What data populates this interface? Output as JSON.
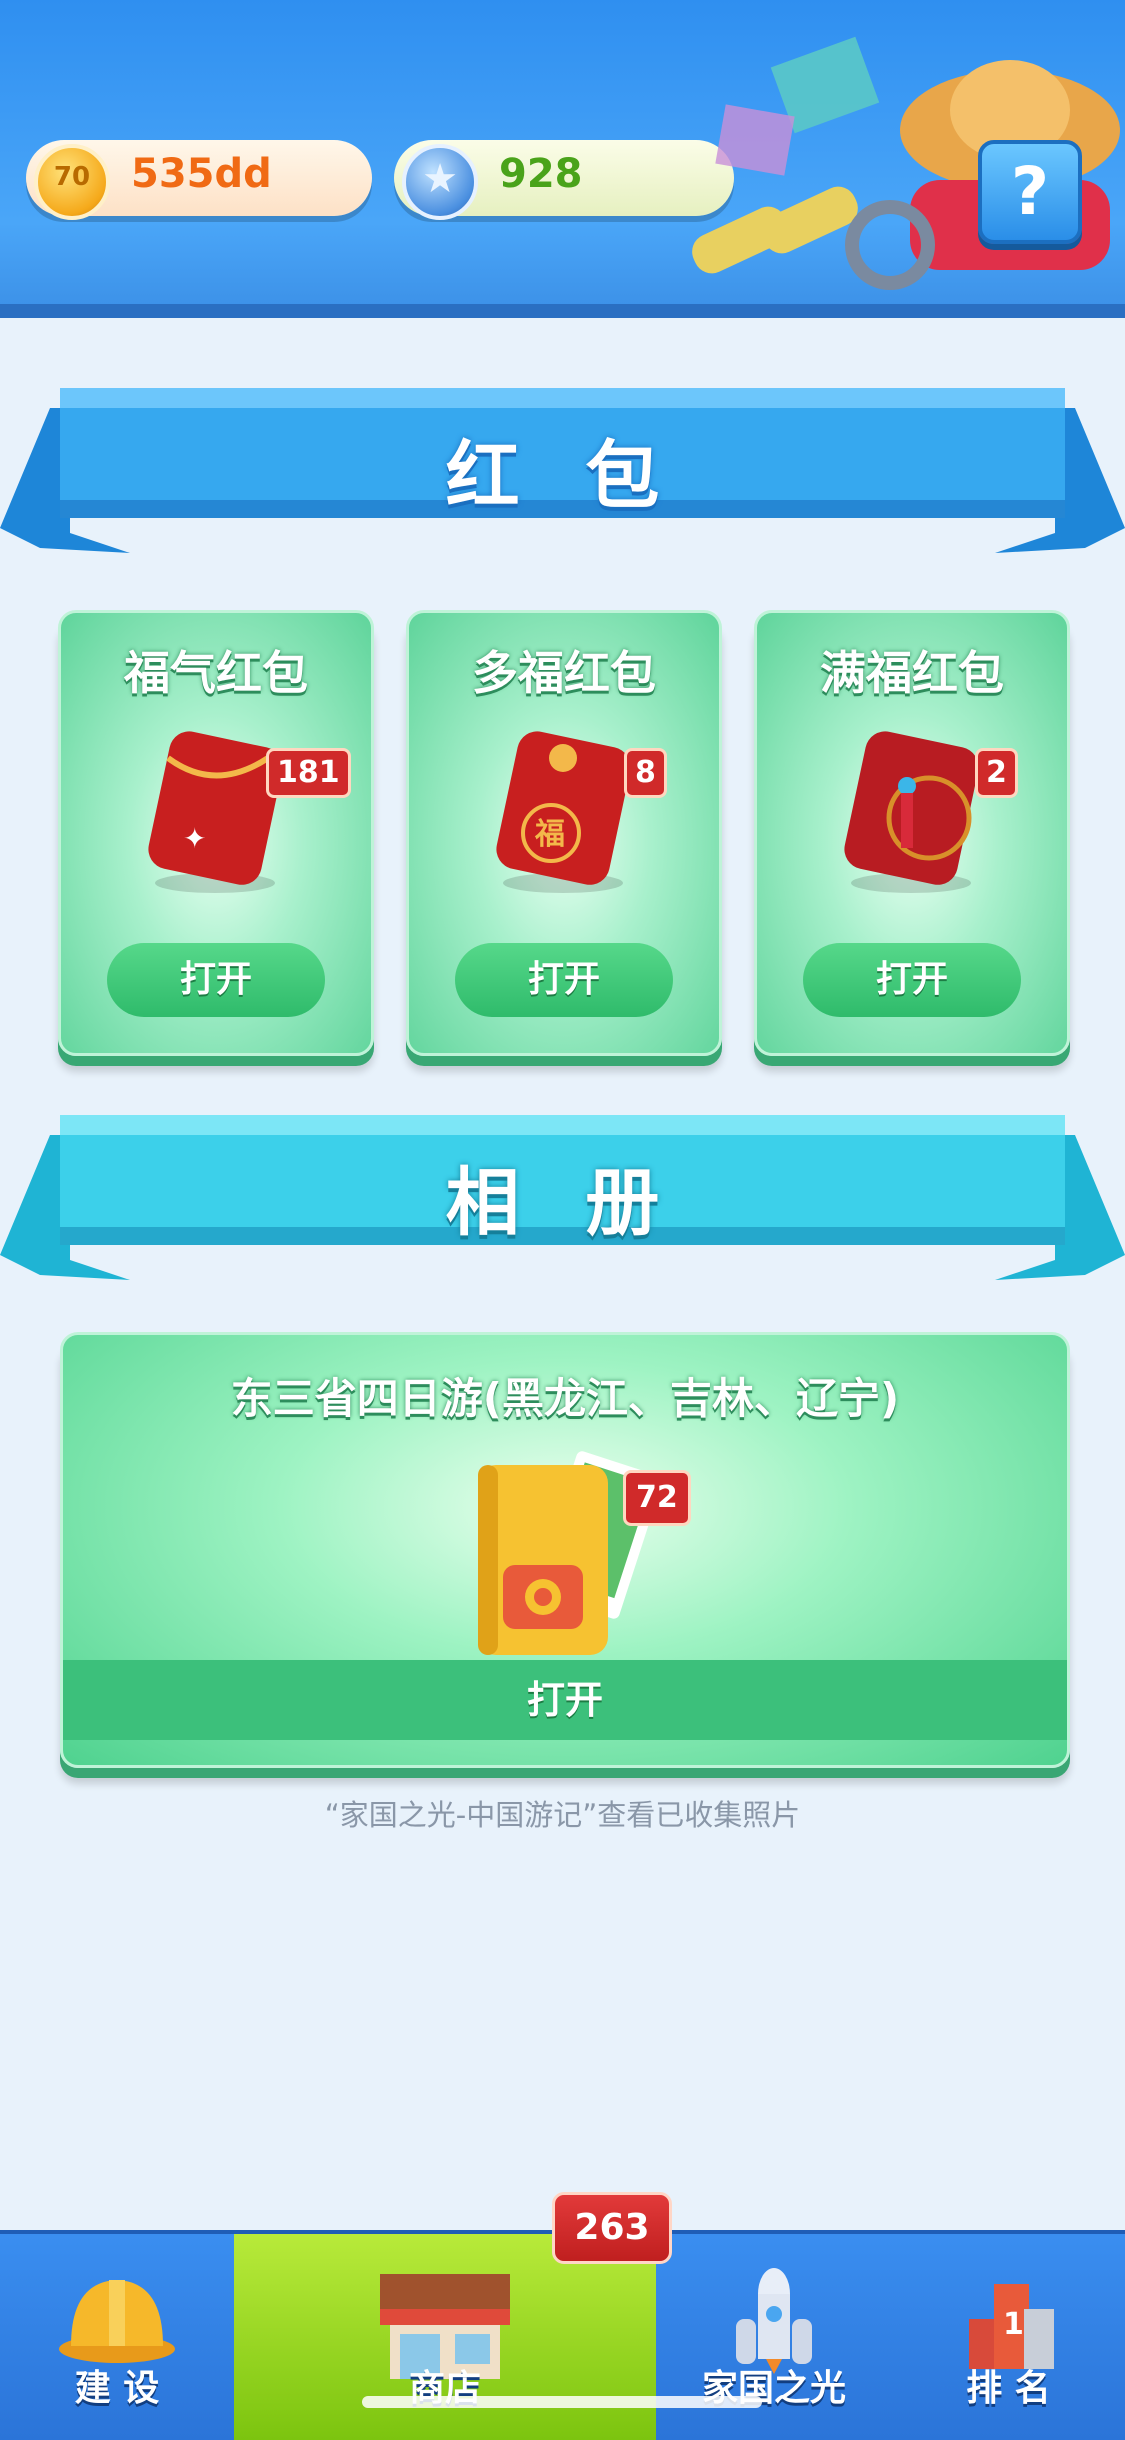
{
  "header": {
    "coin_value": "535dd",
    "coin_icon_text": "70",
    "star_value": "928",
    "help_label": "?"
  },
  "red_packet_section": {
    "title": "红 包",
    "packets": [
      {
        "name": "福气红包",
        "count": "181",
        "open_label": "打开"
      },
      {
        "name": "多福红包",
        "count": "8",
        "open_label": "打开"
      },
      {
        "name": "满福红包",
        "count": "2",
        "open_label": "打开"
      }
    ]
  },
  "album_section": {
    "title": "相 册",
    "album_name": "东三省四日游(黑龙江、吉林、辽宁)",
    "count": "72",
    "open_label": "打开",
    "note": "“家国之光-中国游记”查看已收集照片"
  },
  "bottom_nav": {
    "items": [
      {
        "label": "建 设",
        "icon": "helmet-icon"
      },
      {
        "label": "商店",
        "icon": "shop-icon"
      },
      {
        "label": "家国之光",
        "icon": "rocket-icon"
      },
      {
        "label": "排 名",
        "icon": "ranking-icon"
      }
    ],
    "shop_badge": "263"
  },
  "colors": {
    "header_blue": "#3b98f2",
    "card_green": "#5fd49b",
    "badge_red": "#d02a2a",
    "shop_tab_green": "#9bd62a"
  }
}
